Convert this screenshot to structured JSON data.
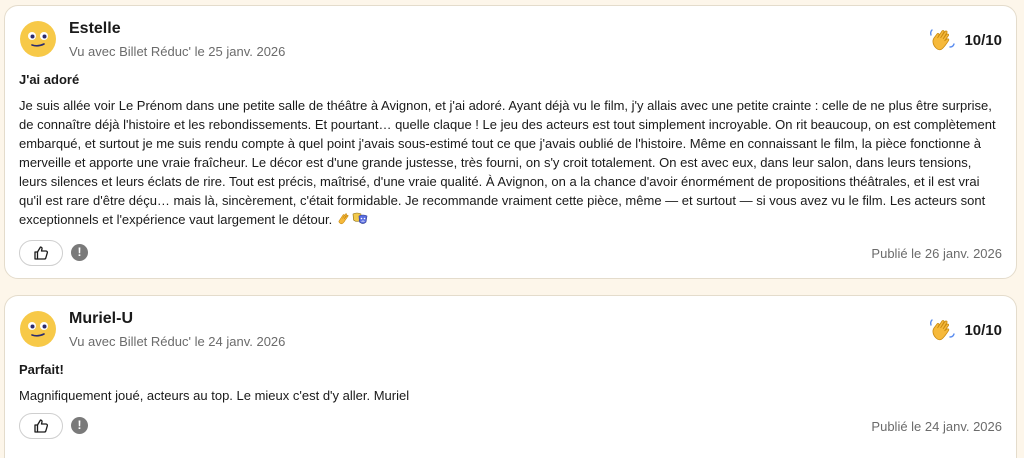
{
  "reviews": [
    {
      "author": "Estelle",
      "subtitle": "Vu avec Billet Réduc' le 25 janv. 2026",
      "score": "10/10",
      "title": "J'ai adoré",
      "body": "Je suis allée voir Le Prénom dans une petite salle de théâtre à Avignon, et j'ai adoré. Ayant déjà vu le film, j'y allais avec une petite crainte : celle de ne plus être surprise, de connaître déjà l'histoire et les rebondissements. Et pourtant… quelle claque ! Le jeu des acteurs est tout simplement incroyable. On rit beaucoup, on est complètement embarqué, et surtout je me suis rendu compte à quel point j'avais sous-estimé tout ce que j'avais oublié de l'histoire. Même en connaissant le film, la pièce fonctionne à merveille et apporte une vraie fraîcheur. Le décor est d'une grande justesse, très fourni, on s'y croit totalement. On est avec eux, dans leur salon, dans leurs tensions, leurs silences et leurs éclats de rire. Tout est précis, maîtrisé, d'une vraie qualité. À Avignon, on a la chance d'avoir énormément de propositions théâtrales, et il est vrai qu'il est rare d'être déçu… mais là, sincèrement, c'était formidable. Je recommande vraiment cette pièce, même — et surtout — si vous avez vu le film. Les acteurs sont exceptionnels et l'expérience vaut largement le détour.",
      "body_emojis": [
        "clapping-hands-emoji",
        "performing-arts-emoji"
      ],
      "published": "Publié le 26 janv. 2026"
    },
    {
      "author": "Muriel-U",
      "subtitle": "Vu avec Billet Réduc' le 24 janv. 2026",
      "score": "10/10",
      "title": "Parfait!",
      "body": "Magnifiquement joué, acteurs au top. Le mieux c'est d'y aller. Muriel",
      "published": "Publié le 24 janv. 2026"
    }
  ],
  "icons": {
    "avatar": "smiling-face-avatar-icon",
    "score": "waving-hand-icon",
    "like": "thumbs-up-icon",
    "report": "exclamation-icon"
  },
  "colors": {
    "page_bg": "#fdf6ea",
    "card_bg": "#ffffff",
    "avatar_yellow": "#f7c948",
    "text_muted": "#6b6b6b"
  }
}
